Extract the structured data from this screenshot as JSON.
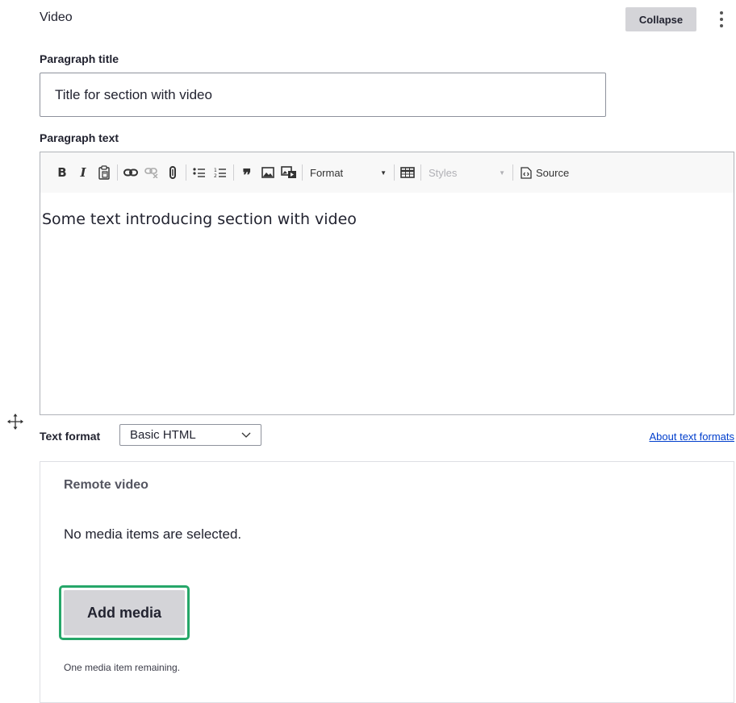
{
  "paragraph": {
    "type_label": "Video",
    "collapse_label": "Collapse",
    "actions_icon": "vertical-dots-icon"
  },
  "title_field": {
    "label": "Paragraph title",
    "value": "Title for section with video"
  },
  "text_field": {
    "label": "Paragraph text",
    "content": "Some text introducing section with video",
    "toolbar": {
      "format_label": "Format",
      "styles_label": "Styles",
      "source_label": "Source"
    }
  },
  "text_format": {
    "label": "Text format",
    "selected": "Basic HTML",
    "about_link": "About text formats"
  },
  "remote_video": {
    "title": "Remote video",
    "empty_message": "No media items are selected.",
    "add_button": "Add media",
    "remaining": "One media item remaining."
  },
  "colors": {
    "focus_ring": "#26a769",
    "button_bg": "#d4d4d8",
    "link": "#003ecc"
  }
}
